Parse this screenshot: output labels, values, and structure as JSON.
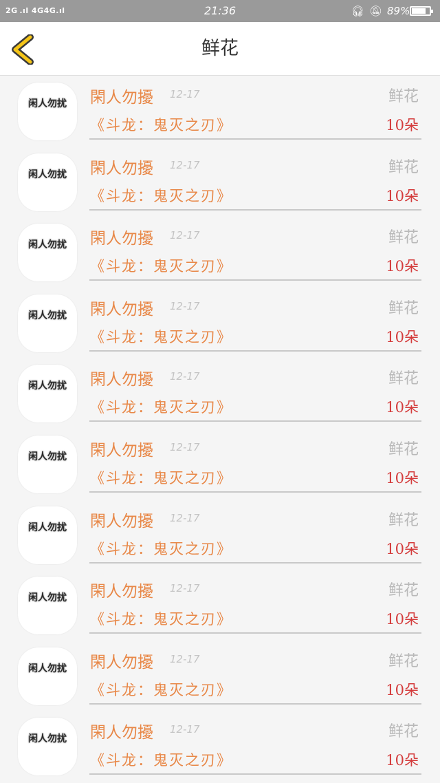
{
  "status_bar": {
    "signal": "2G .ıl 4G4G.ıl",
    "time": "21:36",
    "headset_icon": "headset-icon",
    "bell_icon": "bell-muted-icon",
    "battery": "89%",
    "battery_level": 0.89
  },
  "header": {
    "back_icon": "chevron-left-icon",
    "title": "鲜花"
  },
  "records": [
    {
      "avatar_text": "闲人勿扰",
      "user": "閑人勿擾",
      "date": "12-17",
      "gift": "鲜花",
      "work": "《斗龙：鬼灭之刃》",
      "count": "10朵"
    },
    {
      "avatar_text": "闲人勿扰",
      "user": "閑人勿擾",
      "date": "12-17",
      "gift": "鲜花",
      "work": "《斗龙：鬼灭之刃》",
      "count": "10朵"
    },
    {
      "avatar_text": "闲人勿扰",
      "user": "閑人勿擾",
      "date": "12-17",
      "gift": "鲜花",
      "work": "《斗龙：鬼灭之刃》",
      "count": "10朵"
    },
    {
      "avatar_text": "闲人勿扰",
      "user": "閑人勿擾",
      "date": "12-17",
      "gift": "鲜花",
      "work": "《斗龙：鬼灭之刃》",
      "count": "10朵"
    },
    {
      "avatar_text": "闲人勿扰",
      "user": "閑人勿擾",
      "date": "12-17",
      "gift": "鲜花",
      "work": "《斗龙：鬼灭之刃》",
      "count": "10朵"
    },
    {
      "avatar_text": "闲人勿扰",
      "user": "閑人勿擾",
      "date": "12-17",
      "gift": "鲜花",
      "work": "《斗龙：鬼灭之刃》",
      "count": "10朵"
    },
    {
      "avatar_text": "闲人勿扰",
      "user": "閑人勿擾",
      "date": "12-17",
      "gift": "鲜花",
      "work": "《斗龙：鬼灭之刃》",
      "count": "10朵"
    },
    {
      "avatar_text": "闲人勿扰",
      "user": "閑人勿擾",
      "date": "12-17",
      "gift": "鲜花",
      "work": "《斗龙：鬼灭之刃》",
      "count": "10朵"
    },
    {
      "avatar_text": "闲人勿扰",
      "user": "閑人勿擾",
      "date": "12-17",
      "gift": "鲜花",
      "work": "《斗龙：鬼灭之刃》",
      "count": "10朵"
    },
    {
      "avatar_text": "闲人勿扰",
      "user": "閑人勿擾",
      "date": "12-17",
      "gift": "鲜花",
      "work": "《斗龙：鬼灭之刃》",
      "count": "10朵"
    }
  ]
}
